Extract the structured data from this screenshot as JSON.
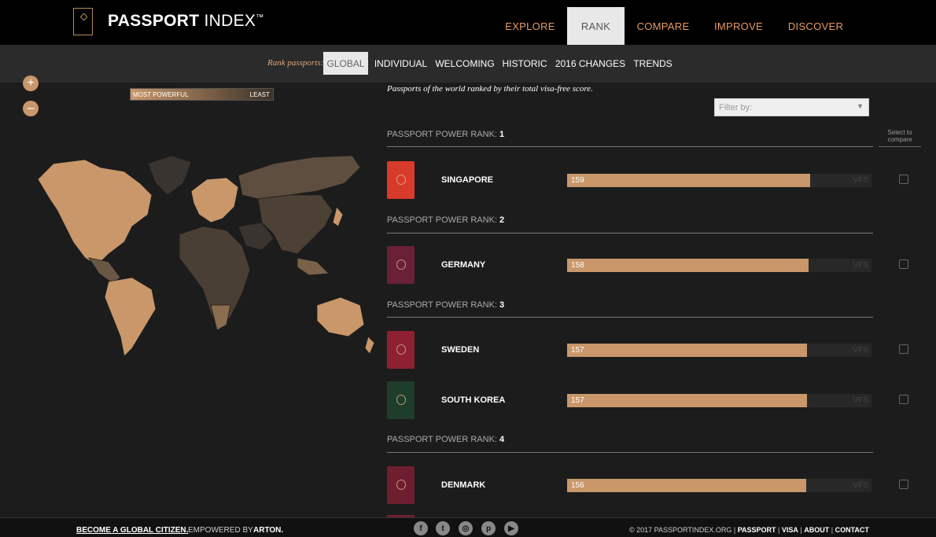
{
  "header": {
    "logo_bold": "PASSPORT",
    "logo_light": " INDEX",
    "logo_tm": "™",
    "nav": [
      "EXPLORE",
      "RANK",
      "COMPARE",
      "IMPROVE",
      "DISCOVER"
    ],
    "active_nav": "RANK"
  },
  "subnav": {
    "label": "Rank passports:",
    "items": [
      "GLOBAL",
      "INDIVIDUAL",
      "WELCOMING",
      "HISTORIC",
      "2016 CHANGES",
      "TRENDS"
    ],
    "active": "GLOBAL"
  },
  "map": {
    "zoom_in": "+",
    "zoom_out": "–",
    "legend_most": "MOST POWERFUL",
    "legend_least": "LEAST"
  },
  "list": {
    "intro": "Passports of the world ranked by their total visa-free score.",
    "filter_placeholder": "Filter by:",
    "compare_header": "Select to compare",
    "rank_label": "PASSPORT POWER RANK:",
    "unit": "VFS",
    "max_score": 193,
    "groups": [
      {
        "rank": "1",
        "countries": [
          {
            "name": "SINGAPORE",
            "score": 159,
            "color": "#d83a2c"
          }
        ]
      },
      {
        "rank": "2",
        "countries": [
          {
            "name": "GERMANY",
            "score": 158,
            "color": "#6a2036"
          }
        ]
      },
      {
        "rank": "3",
        "countries": [
          {
            "name": "SWEDEN",
            "score": 157,
            "color": "#8e2033"
          },
          {
            "name": "SOUTH KOREA",
            "score": 157,
            "color": "#1f3d2b"
          }
        ]
      },
      {
        "rank": "4",
        "countries": [
          {
            "name": "DENMARK",
            "score": 156,
            "color": "#6e1e2f"
          }
        ]
      }
    ]
  },
  "footer": {
    "become": "BECOME A GLOBAL CITIZEN.",
    "empowered": "EMPOWERED BY",
    "arton": "ARTON.",
    "social": [
      "facebook-icon",
      "twitter-icon",
      "instagram-icon",
      "pinterest-icon",
      "youtube-icon"
    ],
    "copyright": "© 2017 PASSPORTINDEX.ORG",
    "links": [
      "PASSPORT",
      "VISA",
      "ABOUT",
      "CONTACT"
    ]
  },
  "colors": {
    "accent": "#c9976a",
    "nav_text": "#e89a63",
    "background": "#1c1c1c"
  }
}
